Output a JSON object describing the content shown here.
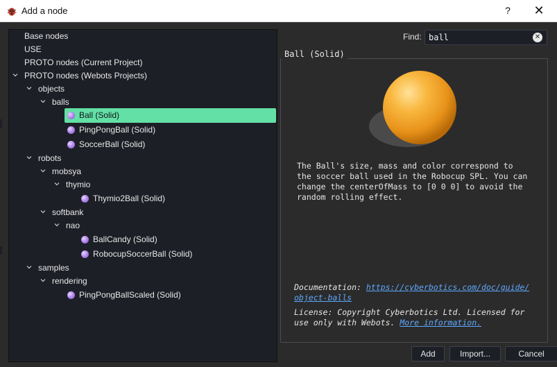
{
  "window": {
    "title": "Add a node",
    "help_label": "?",
    "close_label": "✕"
  },
  "tree": {
    "items": [
      {
        "label": "Base nodes",
        "expanded": null
      },
      {
        "label": "USE",
        "expanded": null
      },
      {
        "label": "PROTO nodes (Current Project)",
        "expanded": null
      },
      {
        "label": "PROTO nodes (Webots Projects)",
        "expanded": true
      },
      {
        "label": "objects",
        "expanded": true
      },
      {
        "label": "balls",
        "expanded": true
      },
      {
        "label": "Ball (Solid)",
        "selected": true
      },
      {
        "label": "PingPongBall (Solid)"
      },
      {
        "label": "SoccerBall (Solid)"
      },
      {
        "label": "robots",
        "expanded": true
      },
      {
        "label": "mobsya",
        "expanded": true
      },
      {
        "label": "thymio",
        "expanded": true
      },
      {
        "label": "Thymio2Ball (Solid)"
      },
      {
        "label": "softbank",
        "expanded": true
      },
      {
        "label": "nao",
        "expanded": true
      },
      {
        "label": "BallCandy (Solid)"
      },
      {
        "label": "RobocupSoccerBall (Solid)"
      },
      {
        "label": "samples",
        "expanded": true
      },
      {
        "label": "rendering",
        "expanded": true
      },
      {
        "label": "PingPongBallScaled (Solid)"
      }
    ]
  },
  "search": {
    "label": "Find:",
    "value": "ball"
  },
  "details": {
    "title": "Ball (Solid)",
    "description": "The Ball's size, mass and color correspond to\nthe soccer ball used in the Robocup SPL. You can\nchange the centerOfMass to [0 0 0] to avoid the\nrandom rolling effect.",
    "documentation_label": "Documentation:",
    "documentation_link": "https://cyberbotics.com/doc/guide/\nobject-balls",
    "license_text": "License: Copyright Cyberbotics Ltd. Licensed for\nuse only with Webots.",
    "license_link": "More information."
  },
  "buttons": {
    "add": "Add",
    "import": "Import...",
    "cancel": "Cancel"
  },
  "colors": {
    "selection": "#63e0a5",
    "background": "#2b2b2b",
    "panel": "#1d1f26",
    "link": "#5fa8ff",
    "ball": "#f5a623"
  }
}
